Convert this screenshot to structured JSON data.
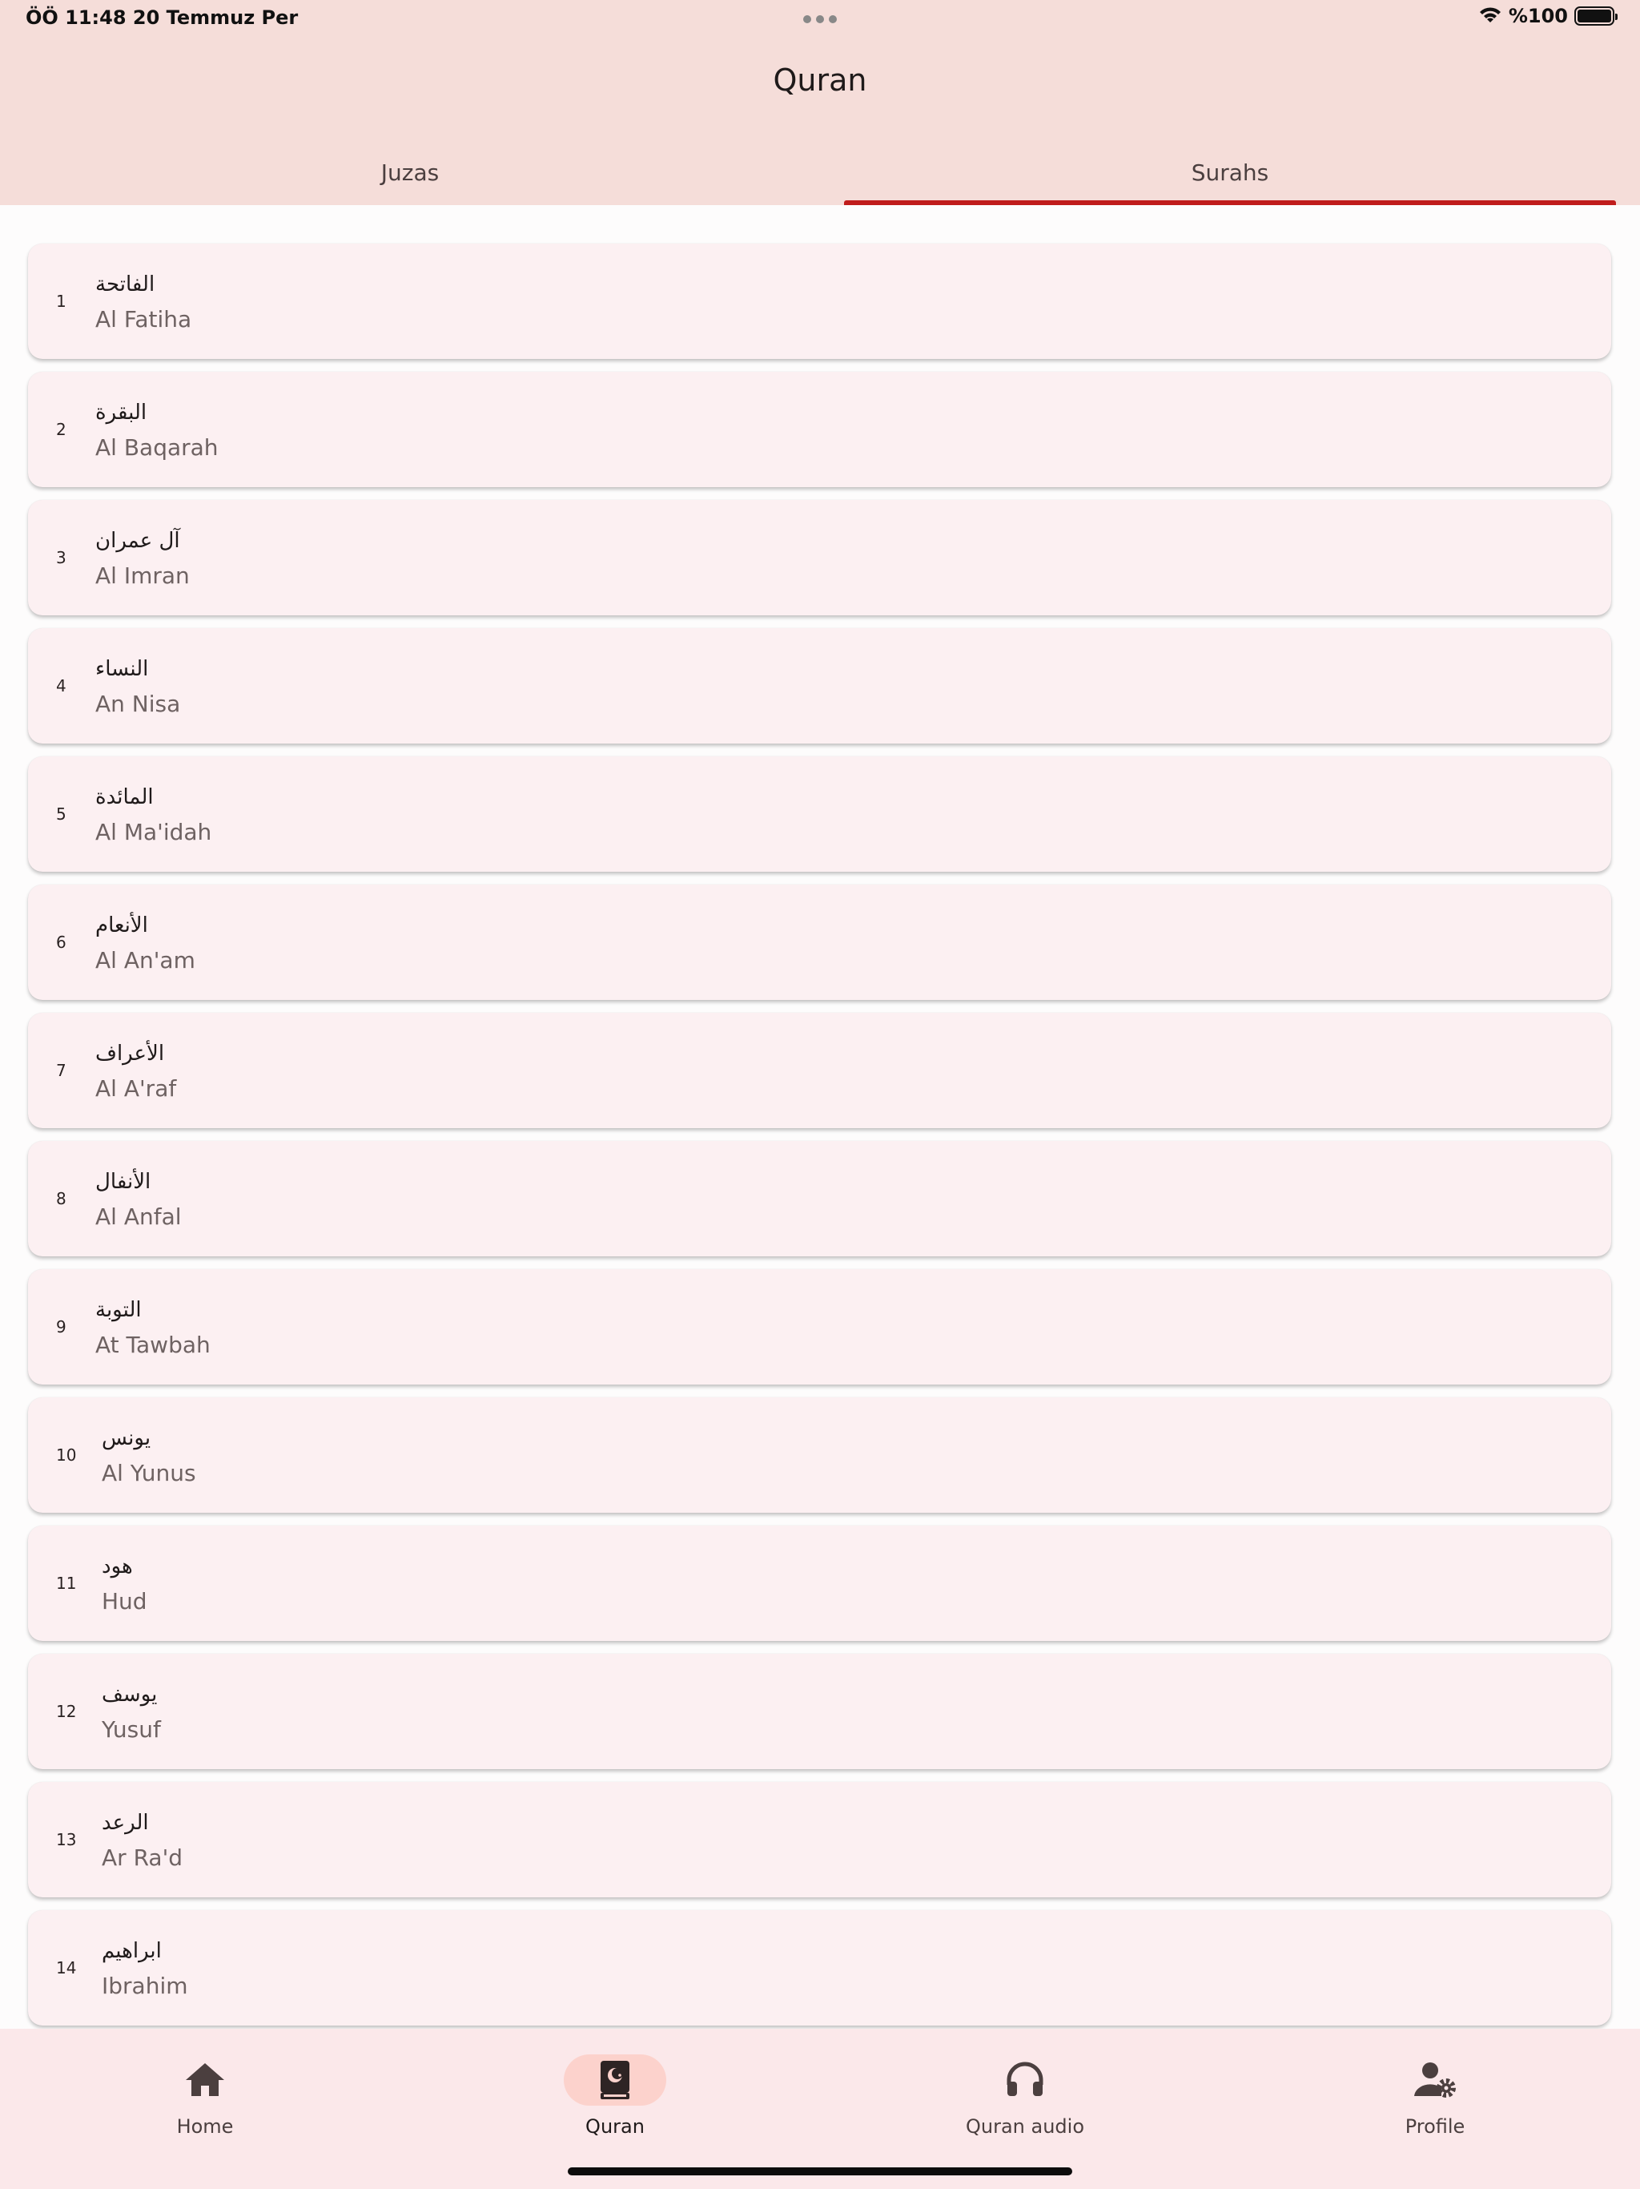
{
  "status_bar": {
    "time_date": "ÖÖ 11:48   20 Temmuz Per",
    "battery": "%100",
    "battery_level": 1.0
  },
  "header": {
    "title": "Quran"
  },
  "tabs": [
    {
      "label": "Juzas",
      "selected": false
    },
    {
      "label": "Surahs",
      "selected": true
    }
  ],
  "accent_color": "#c01c1c",
  "surahs": [
    {
      "number": "1",
      "arabic": "الفاتحة",
      "name": "Al Fatiha"
    },
    {
      "number": "2",
      "arabic": "البقرة",
      "name": "Al Baqarah"
    },
    {
      "number": "3",
      "arabic": "آل عمران",
      "name": "Al Imran"
    },
    {
      "number": "4",
      "arabic": "النساء",
      "name": "An Nisa"
    },
    {
      "number": "5",
      "arabic": "المائدة",
      "name": "Al Ma'idah"
    },
    {
      "number": "6",
      "arabic": "الأنعام",
      "name": "Al An'am"
    },
    {
      "number": "7",
      "arabic": "الأعراف",
      "name": "Al A'raf"
    },
    {
      "number": "8",
      "arabic": "الأنفال",
      "name": "Al Anfal"
    },
    {
      "number": "9",
      "arabic": "التوبة",
      "name": "At Tawbah"
    },
    {
      "number": "10",
      "arabic": "يونس",
      "name": "Al Yunus"
    },
    {
      "number": "11",
      "arabic": "هود",
      "name": "Hud"
    },
    {
      "number": "12",
      "arabic": "يوسف",
      "name": "Yusuf"
    },
    {
      "number": "13",
      "arabic": "الرعد",
      "name": "Ar Ra'd"
    },
    {
      "number": "14",
      "arabic": "ابراهيم",
      "name": "Ibrahim"
    }
  ],
  "bottom_nav": [
    {
      "label": "Home",
      "icon": "home-icon",
      "active": false
    },
    {
      "label": "Quran",
      "icon": "quran-book-icon",
      "active": true
    },
    {
      "label": "Quran audio",
      "icon": "headphones-icon",
      "active": false
    },
    {
      "label": "Profile",
      "icon": "profile-settings-icon",
      "active": false
    }
  ]
}
